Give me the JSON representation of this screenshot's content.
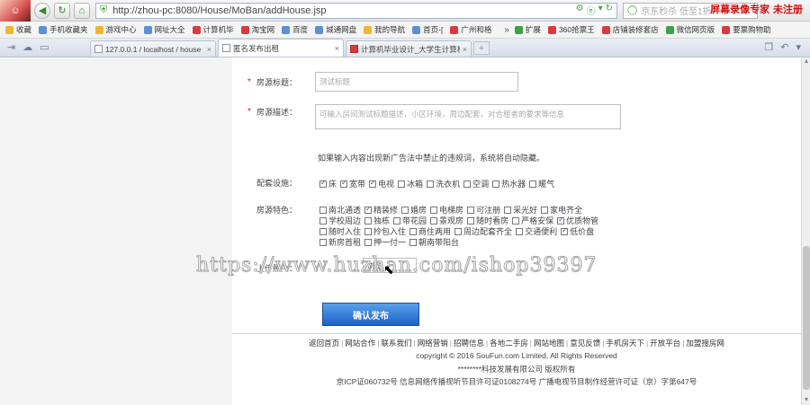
{
  "browser": {
    "url": "http://zhou-pc:8080/House/MoBan/addHouse.jsp",
    "search_placeholder": "京东秒杀 低至1折",
    "recorder_watermark": "屏幕录像专家 未注册",
    "bookmarks": [
      {
        "label": "收藏",
        "icon": "y"
      },
      {
        "label": "手机收藏夹",
        "icon": "b"
      },
      {
        "label": "游戏中心",
        "icon": "y"
      },
      {
        "label": "网址大全",
        "icon": "b"
      },
      {
        "label": "计算机毕",
        "icon": "r"
      },
      {
        "label": "淘宝网",
        "icon": "r"
      },
      {
        "label": "百度",
        "icon": "b"
      },
      {
        "label": "城通网盘",
        "icon": "b"
      },
      {
        "label": "我的导航",
        "icon": "y"
      },
      {
        "label": "首页-[",
        "icon": "b"
      },
      {
        "label": "广州和格",
        "icon": "r"
      },
      {
        "label": "扩展",
        "icon": "g"
      },
      {
        "label": "360抢票王",
        "icon": "r"
      },
      {
        "label": "店铺装修套店",
        "icon": "r"
      },
      {
        "label": "微信网页版",
        "icon": "g"
      },
      {
        "label": "要票购物助",
        "icon": "r"
      }
    ],
    "bookmark_more": "»",
    "tabs": [
      {
        "label": "127.0.0.1 / localhost / house",
        "active": false
      },
      {
        "label": "匿名发布出租",
        "active": true
      },
      {
        "label": "计算机毕业设计_大学生计算机",
        "active": false
      }
    ],
    "tab_add": "+"
  },
  "form": {
    "title_label": "房源标题：",
    "title_placeholder": "测试标题",
    "desc_label": "房源描述：",
    "desc_placeholder": "可输入房间测试标题描述，小区环境，周边配套，对合租者的要求等信息",
    "notice": "如果输入内容出现新广告法中禁止的违规词，系统将自动隐藏。",
    "facilities_label": "配套设施：",
    "facilities": [
      {
        "label": "床",
        "checked": true
      },
      {
        "label": "宽带",
        "checked": true
      },
      {
        "label": "电视",
        "checked": true
      },
      {
        "label": "冰箱",
        "checked": false
      },
      {
        "label": "洗衣机",
        "checked": false
      },
      {
        "label": "空调",
        "checked": false
      },
      {
        "label": "热水器",
        "checked": false
      },
      {
        "label": "暖气",
        "checked": false
      }
    ],
    "features_label": "房源特色：",
    "features": [
      {
        "label": "南北通透",
        "checked": false
      },
      {
        "label": "精装修",
        "checked": true
      },
      {
        "label": "婚房",
        "checked": false
      },
      {
        "label": "电梯房",
        "checked": false
      },
      {
        "label": "可注册",
        "checked": false
      },
      {
        "label": "采光好",
        "checked": false
      },
      {
        "label": "家电齐全",
        "checked": false
      },
      {
        "label": "学校周边",
        "checked": false
      },
      {
        "label": "独栋",
        "checked": false
      },
      {
        "label": "带花园",
        "checked": false
      },
      {
        "label": "景观房",
        "checked": false
      },
      {
        "label": "随时看房",
        "checked": false
      },
      {
        "label": "严格安保",
        "checked": false
      },
      {
        "label": "优质物管",
        "checked": true
      },
      {
        "label": "随时入住",
        "checked": false
      },
      {
        "label": "拎包入住",
        "checked": false
      },
      {
        "label": "商住两用",
        "checked": false
      },
      {
        "label": "周边配套齐全",
        "checked": false
      },
      {
        "label": "交通便利",
        "checked": false
      },
      {
        "label": "低价盘",
        "checked": true
      },
      {
        "label": "新房首租",
        "checked": false
      },
      {
        "label": "押一付一",
        "checked": false
      },
      {
        "label": "朝南带阳台",
        "checked": false
      }
    ],
    "photo_label": "上传照片：",
    "photo_button": "浏览...",
    "submit_label": "确认发布"
  },
  "footer": {
    "links": [
      "返回首页",
      "网站合作",
      "联系我们",
      "网络营销",
      "招聘信息",
      "各地二手房",
      "网站地图",
      "意见反馈",
      "手机房天下",
      "开放平台",
      "加盟搜房网"
    ],
    "copyright": "copyright © 2016 SouFun.com Limited, All Rights Reserved",
    "company": "********科技发展有限公司 版权所有",
    "icp": "京ICP证060732号 信息网络传播视听节目许可证0108274号 广播电视节目制作经营许可证（京）字第647号"
  },
  "overlay_watermark": "https://www.huzhan.com/ishop39397"
}
